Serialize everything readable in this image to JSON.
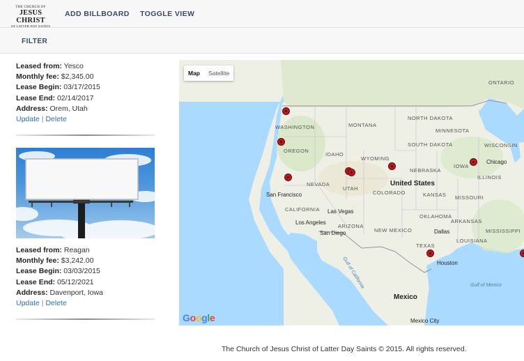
{
  "nav": {
    "brand_line1": "THE CHURCH OF",
    "brand_line2": "JESUS CHRIST",
    "brand_line3": "OF LATTER-DAY SAINTS",
    "add_billboard": "ADD BILLBOARD",
    "toggle_view": "TOGGLE VIEW"
  },
  "filter": {
    "label": "FILTER"
  },
  "listings": [
    {
      "leased_from_label": "Leased from:",
      "leased_from": "Yesco",
      "monthly_fee_label": "Monthly fee:",
      "monthly_fee": "$2,345.00",
      "lease_begin_label": "Lease Begin:",
      "lease_begin": "03/17/2015",
      "lease_end_label": "Lease End:",
      "lease_end": "02/14/2017",
      "address_label": "Address:",
      "address": "Orem, Utah",
      "update": "Update",
      "separator": "|",
      "delete": "Delete"
    },
    {
      "leased_from_label": "Leased from:",
      "leased_from": "Reagan",
      "monthly_fee_label": "Monthly fee:",
      "monthly_fee": "$3,242.00",
      "lease_begin_label": "Lease Begin:",
      "lease_begin": "03/03/2015",
      "lease_end_label": "Lease End:",
      "lease_end": "05/12/2021",
      "address_label": "Address:",
      "address": "Davenport, Iowa",
      "update": "Update",
      "separator": "|",
      "delete": "Delete"
    }
  ],
  "map": {
    "type_map": "Map",
    "type_satellite": "Satellite",
    "google": [
      "G",
      "o",
      "o",
      "g",
      "l",
      "e"
    ],
    "google_colors": [
      "#4285F4",
      "#EA4335",
      "#FBBC05",
      "#4285F4",
      "#34A853",
      "#EA4335"
    ],
    "country_us": "United States",
    "country_mexico": "Mexico",
    "states": [
      "WASHINGTON",
      "OREGON",
      "IDAHO",
      "MONTANA",
      "WYOMING",
      "NEVADA",
      "UTAH",
      "COLORADO",
      "CALIFORNIA",
      "ARIZONA",
      "NEW MEXICO",
      "NORTH DAKOTA",
      "SOUTH DAKOTA",
      "NEBRASKA",
      "KANSAS",
      "OKLAHOMA",
      "TEXAS",
      "MINNESOTA",
      "WISCONSIN",
      "IOWA",
      "ILLINOIS",
      "MISSOURI",
      "ARKANSAS",
      "MISSISSIPPI",
      "LOUISIANA",
      "ONTARIO"
    ],
    "cities": [
      "San Francisco",
      "Las Vegas",
      "Los Angeles",
      "San Diego",
      "Dallas",
      "Houston",
      "Chicago",
      "Mexico City"
    ],
    "water": [
      "Gulf of California",
      "Gulf of Mexico"
    ]
  },
  "footer": {
    "text": "The Church of Jesus Christ of Latter Day Saints © 2015. All rights reserved."
  }
}
